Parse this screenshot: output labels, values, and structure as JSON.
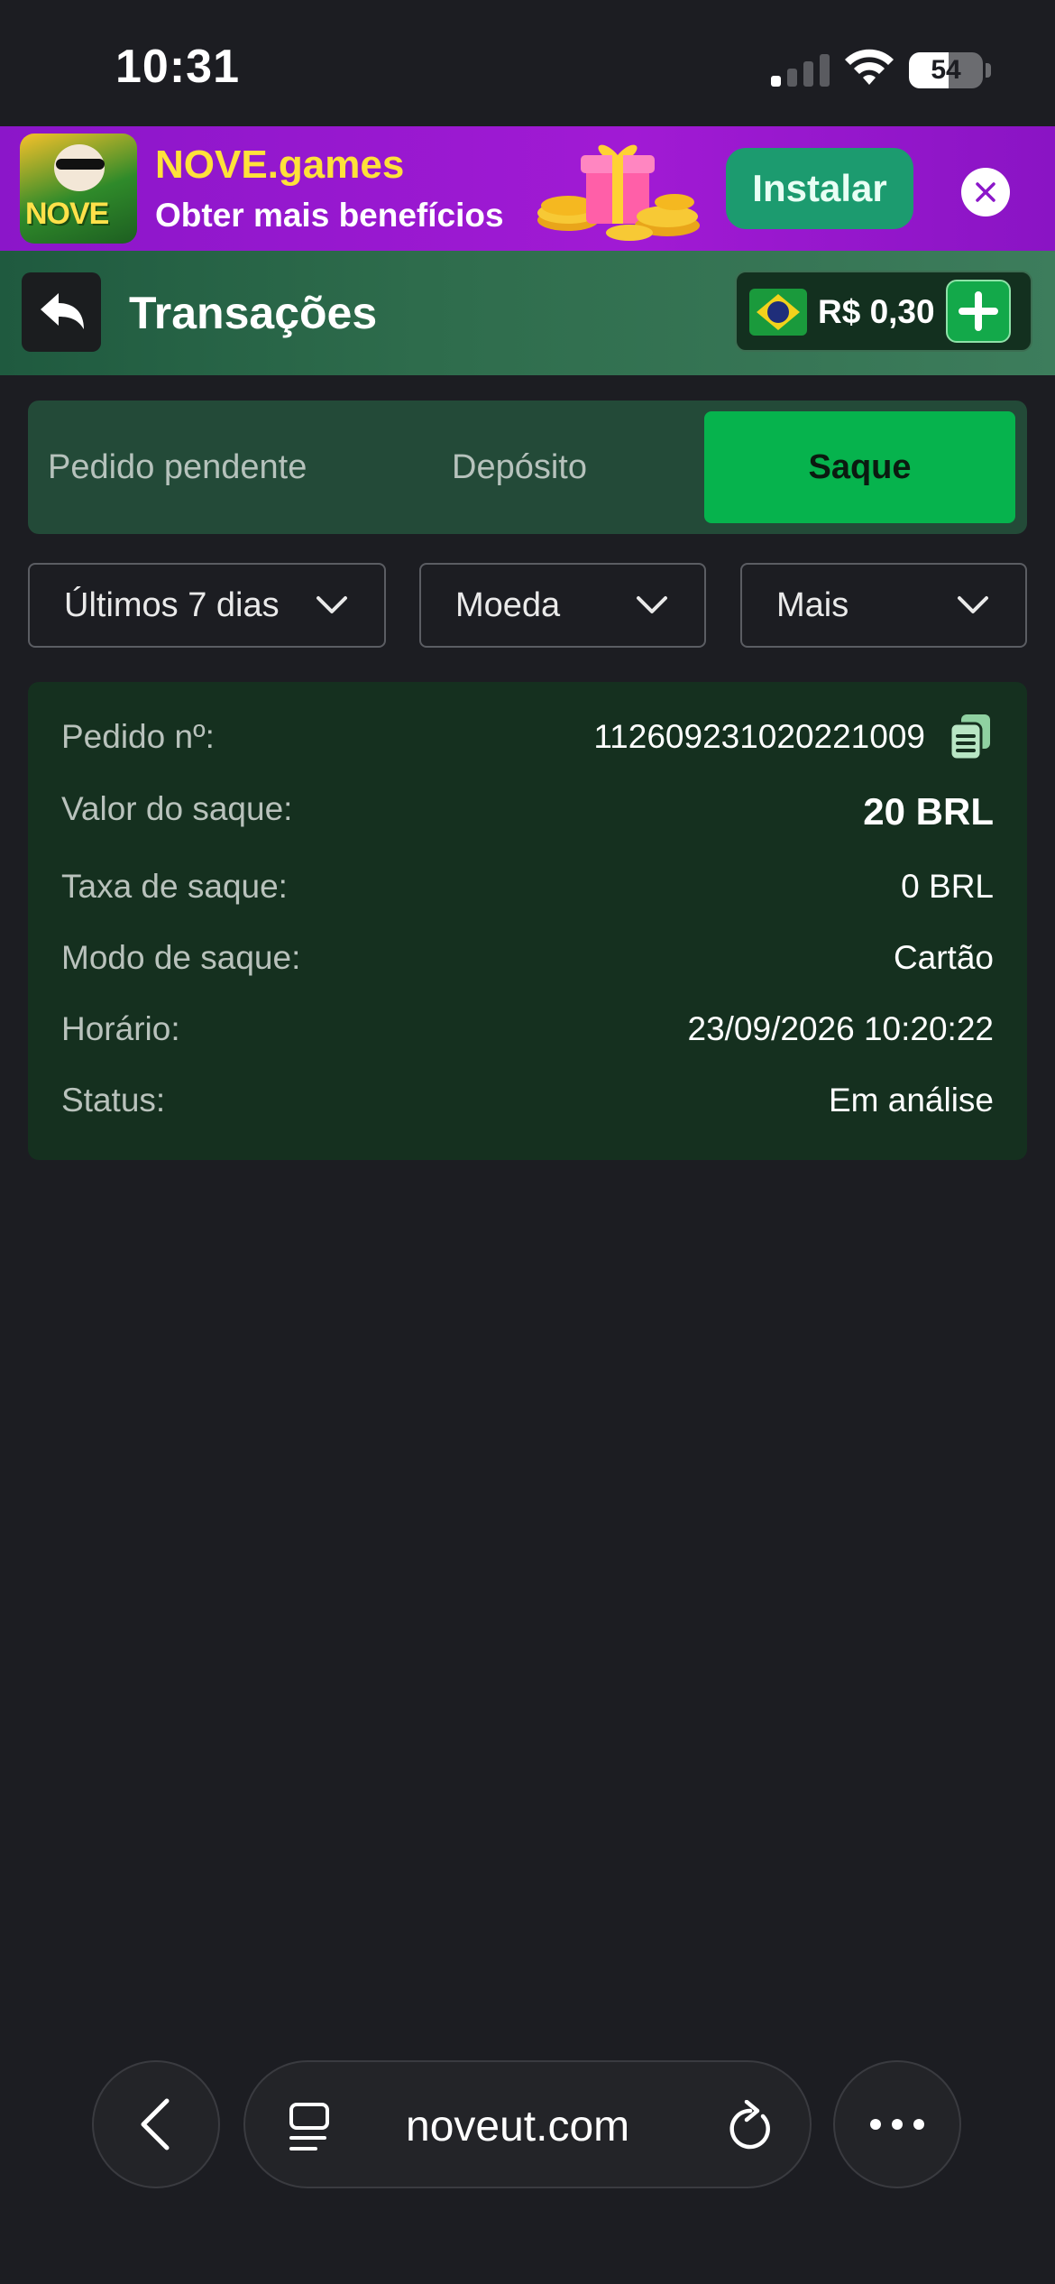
{
  "status_bar": {
    "time": "10:31",
    "battery": "54",
    "battery_level": 0.54
  },
  "promo": {
    "logo_text": "NOVE",
    "title": "NOVE.games",
    "subtitle": "Obter mais benefícios",
    "install_label": "Instalar"
  },
  "header": {
    "title": "Transações",
    "balance": "R$ 0,30"
  },
  "tabs": [
    {
      "label": "Pedido pendente",
      "active": false
    },
    {
      "label": "Depósito",
      "active": false
    },
    {
      "label": "Saque",
      "active": true
    }
  ],
  "filters": [
    {
      "label": "Últimos 7 dias"
    },
    {
      "label": "Moeda"
    },
    {
      "label": "Mais"
    }
  ],
  "transaction": {
    "order_label": "Pedido nº:",
    "order_value": "112609231020221009",
    "amount_label": "Valor do saque:",
    "amount_value": "20 BRL",
    "fee_label": "Taxa de saque:",
    "fee_value": "0 BRL",
    "mode_label": "Modo de saque:",
    "mode_value": "Cartão",
    "time_label": "Horário:",
    "time_value": "23/09/2026 10:20:22",
    "status_label": "Status:",
    "status_value": "Em análise"
  },
  "browser": {
    "url": "noveut.com"
  },
  "colors": {
    "background": "#1c1d22",
    "accent_green": "#06b34d",
    "card": "#15301f",
    "promo_purple": "#a11ad4"
  }
}
